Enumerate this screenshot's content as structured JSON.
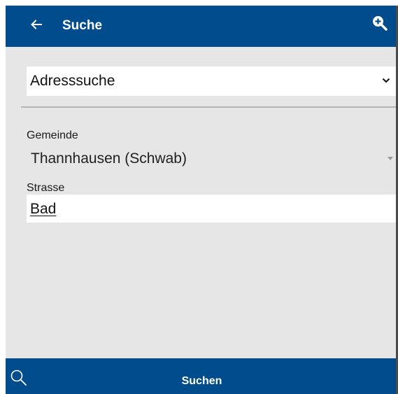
{
  "appbar": {
    "title": "Suche",
    "back_icon": "arrow-left-icon",
    "zoom_icon": "zoom-in-icon"
  },
  "search_type": {
    "selected": "Adresssuche",
    "icon": "chevron-down-icon"
  },
  "gemeinde": {
    "label": "Gemeinde",
    "value": "Thannhausen (Schwab)",
    "icon": "caret-down-icon"
  },
  "strasse": {
    "label": "Strasse",
    "value": "Bad"
  },
  "bottombar": {
    "icon": "search-icon",
    "label": "Suchen"
  },
  "colors": {
    "primary": "#004c8c",
    "background": "#e6e6e6",
    "surface": "#ffffff"
  }
}
